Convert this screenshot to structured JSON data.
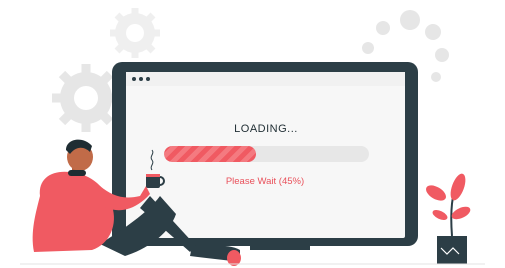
{
  "screen": {
    "title": "LOADING...",
    "status": "Please Wait (45%)",
    "progress_fraction": 0.45
  },
  "icons": [
    "window-dots-icon",
    "gear-icon",
    "steam-icon",
    "plant-icon",
    "coffee-mug-icon"
  ],
  "colors": {
    "accent": "#f05a62",
    "laptop_frame": "#2c3e46",
    "screen_bg": "#f7f7f7",
    "track": "#e7e7e7",
    "gear": "#eeeeee"
  }
}
